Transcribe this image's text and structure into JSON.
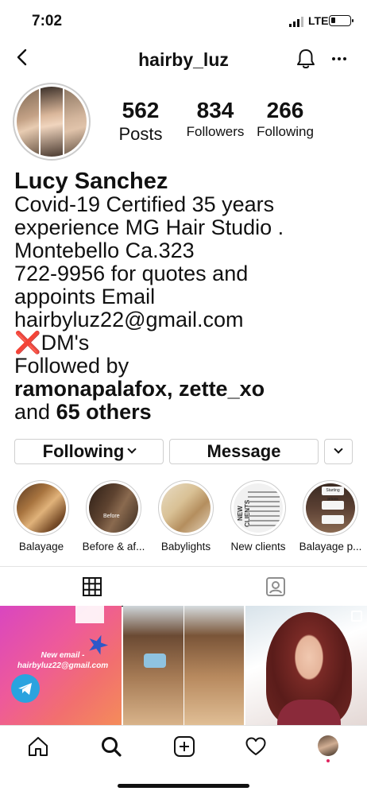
{
  "status_bar": {
    "time": "7:02",
    "network": "LTE"
  },
  "nav": {
    "username": "hairby_luz"
  },
  "profile": {
    "stats": [
      {
        "value": "562",
        "label": "Posts"
      },
      {
        "value": "834",
        "label": "Followers"
      },
      {
        "value": "266",
        "label": "Following"
      }
    ],
    "name": "Lucy Sanchez",
    "bio_lines": [
      "Covid-19 Certified 35 years",
      "experience MG Hair Studio .",
      "Montebello Ca.323",
      "722-9956 for quotes and",
      "appoints Email",
      "hairbyluz22@gmail.com"
    ],
    "bio_dm": "DM's",
    "bio_dm_mark": "❌",
    "followed_by_label": "Followed by",
    "followed_by_names": "ramonapalafox, zette_xo",
    "followed_by_and": "and",
    "followed_by_others": "65 others"
  },
  "actions": {
    "following_label": "Following",
    "message_label": "Message"
  },
  "highlights": [
    {
      "label": "Balayage"
    },
    {
      "label": "Before & af...",
      "overlay_text": "Before"
    },
    {
      "label": "Babylights"
    },
    {
      "label": "New clients",
      "overlay_text": "NEW CLIENTS"
    },
    {
      "label": "Balayage p...",
      "overlay_text": "Starting prices"
    }
  ],
  "posts": [
    {
      "type": "text-graphic",
      "text": "New email - hairbyluz22@gmail.com",
      "badge": "Sign"
    },
    {
      "type": "before-after"
    },
    {
      "type": "photo",
      "multi": true
    }
  ],
  "colors": {
    "dm_mark": "#d62828",
    "notification_dot": "#e0245e",
    "post1_gradient_start": "#d946c0",
    "post1_gradient_end": "#f48c5a"
  },
  "icons": {
    "nav": [
      "back-arrow-icon",
      "bell-icon",
      "more-icon"
    ],
    "tabs": [
      "grid-icon",
      "tagged-icon"
    ],
    "bottom": [
      "home-icon",
      "search-icon",
      "add-icon",
      "heart-icon",
      "profile-avatar-icon"
    ]
  }
}
